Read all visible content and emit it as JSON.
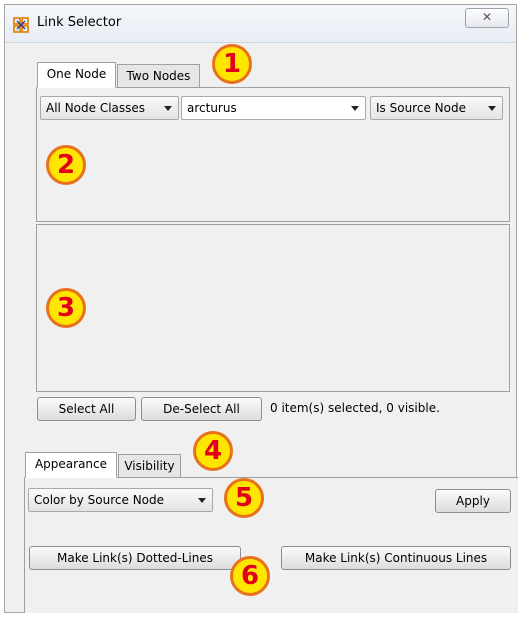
{
  "window": {
    "title": "Link Selector",
    "close_glyph": "✕",
    "app_icon": "network-grid-icon"
  },
  "node_tabs": [
    {
      "label": "One Node"
    },
    {
      "label": "Two Nodes"
    }
  ],
  "node_filter": {
    "node_class": "All Node Classes",
    "node": "arcturus",
    "relation": "Is Source Node"
  },
  "selection": {
    "select_all_label": "Select All",
    "deselect_all_label": "De-Select All",
    "status": "0 item(s) selected, 0 visible."
  },
  "style_tabs": [
    {
      "label": "Appearance"
    },
    {
      "label": "Visibility"
    }
  ],
  "appearance": {
    "color_mode": "Color by Source Node",
    "apply_label": "Apply",
    "dotted_label": "Make Link(s) Dotted-Lines",
    "continuous_label": "Make Link(s) Continuous Lines"
  },
  "callouts": [
    "1",
    "2",
    "3",
    "4",
    "5",
    "6"
  ],
  "colors": {
    "callout_fill": "#ffe600",
    "callout_border": "#e8711c",
    "callout_text": "#e0001a"
  }
}
